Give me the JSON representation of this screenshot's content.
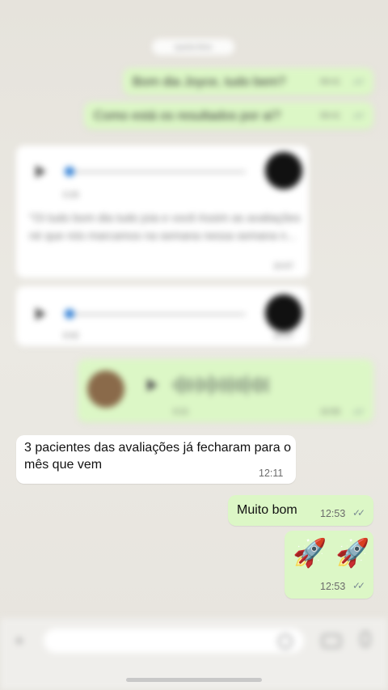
{
  "chat": {
    "date_chip": "quarta-feira",
    "messages": [
      {
        "id": "m1",
        "direction": "outgoing",
        "text": "Bom dia Joyce, tudo bem?",
        "time": "09:41"
      },
      {
        "id": "m2",
        "direction": "outgoing",
        "text": "Como está os resultados por aí?",
        "time": "09:41"
      },
      {
        "id": "m3",
        "direction": "incoming",
        "type": "audio",
        "duration": "0:25",
        "transcript": "\"Oi tudo bom dia tudo joia e você Assim as avaliações né que nós marcamos na semana nessa semana n...",
        "time": "10:07"
      },
      {
        "id": "m4",
        "direction": "incoming",
        "type": "audio",
        "duration": "0:02",
        "time": "10:07"
      },
      {
        "id": "m5",
        "direction": "outgoing",
        "type": "audio",
        "duration": "0:21",
        "time": "10:55"
      },
      {
        "id": "m6",
        "direction": "incoming",
        "text": "3 pacientes das avaliações já fecharam para o mês que vem",
        "time": "12:11"
      },
      {
        "id": "m7",
        "direction": "outgoing",
        "text": "Muito bom",
        "time": "12:53"
      },
      {
        "id": "m8",
        "direction": "outgoing",
        "type": "emoji",
        "text": "🚀 🚀",
        "time": "12:53"
      }
    ]
  },
  "composer": {
    "placeholder": ""
  },
  "icons": {
    "read_receipt": "✓✓",
    "plus": "+",
    "colors": {
      "outgoing_bubble": "#dcf7c6",
      "incoming_bubble": "#ffffff",
      "audio_dot": "#2f7fd6"
    }
  }
}
